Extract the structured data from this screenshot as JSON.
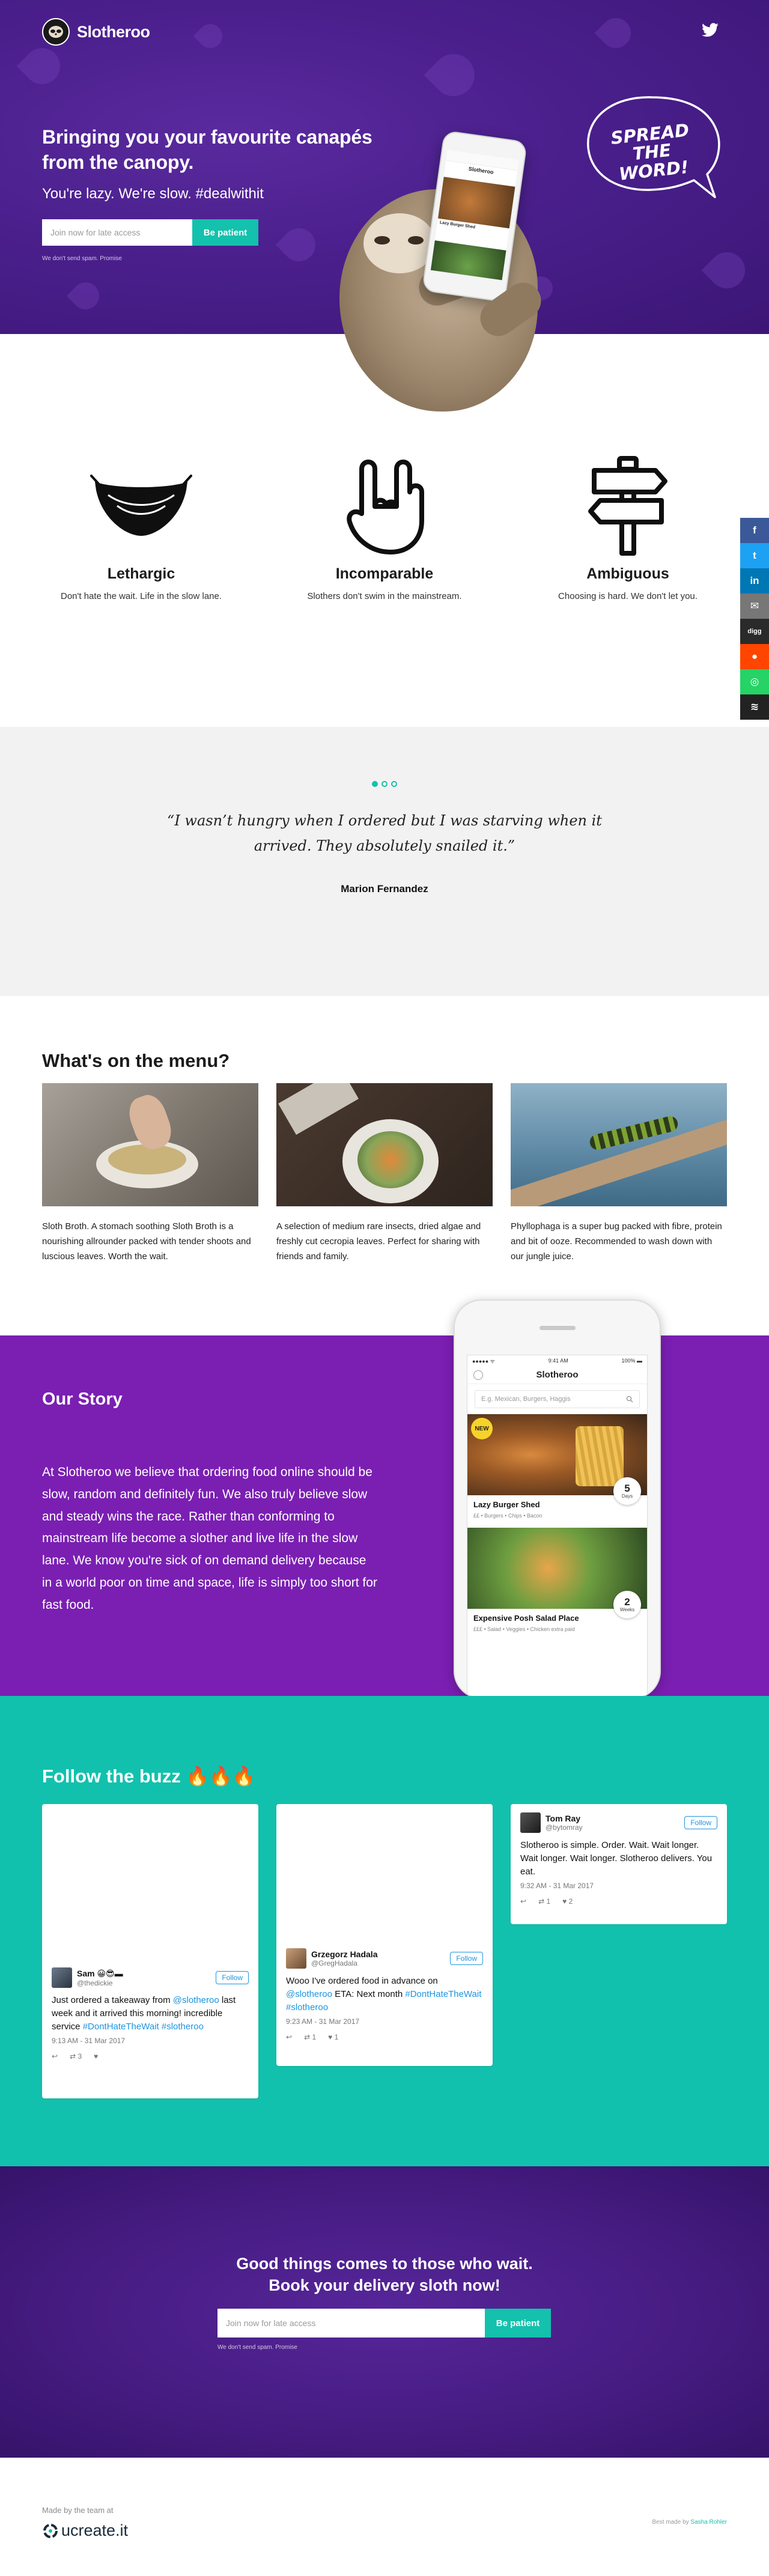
{
  "brand": {
    "name": "Slotheroo"
  },
  "header": {
    "twitter_icon": "twitter-icon"
  },
  "hero": {
    "title": "Bringing you your favourite canapés from the canopy.",
    "subtitle": "You're lazy. We're slow. #dealwithit",
    "signup": {
      "placeholder": "Join now for late access",
      "button_label": "Be patient"
    },
    "no_spam": "We don't send spam. Promise",
    "badge_text": "SPREAD THE WORD!",
    "phone_app_title": "Slotheroo",
    "phone_card_label": "Lazy Burger Shed"
  },
  "share": [
    {
      "name": "facebook",
      "glyph": "f",
      "color": "#3b5998"
    },
    {
      "name": "twitter",
      "glyph": "t",
      "color": "#1da1f2"
    },
    {
      "name": "linkedin",
      "glyph": "in",
      "color": "#0077b5"
    },
    {
      "name": "email",
      "glyph": "✉",
      "color": "#777777"
    },
    {
      "name": "digg",
      "glyph": "digg",
      "color": "#2a2a2a"
    },
    {
      "name": "reddit",
      "glyph": "●",
      "color": "#ff4500"
    },
    {
      "name": "whatsapp",
      "glyph": "◎",
      "color": "#25d366"
    },
    {
      "name": "buffer",
      "glyph": "≋",
      "color": "#222222"
    }
  ],
  "features": [
    {
      "icon": "hammock-icon",
      "title": "Lethargic",
      "desc": "Don't hate the wait. Life in the slow lane."
    },
    {
      "icon": "rock-hand-icon",
      "title": "Incomparable",
      "desc": "Slothers don't swim in the mainstream."
    },
    {
      "icon": "signpost-icon",
      "title": "Ambiguous",
      "desc": "Choosing is hard. We don't let you."
    }
  ],
  "testimonial": {
    "quote": "“I wasn’t hungry when I ordered but I was starving when it arrived. They absolutely snailed it.”",
    "author": "Marion Fernandez",
    "active_index": 0,
    "count": 3
  },
  "menu": {
    "title": "What's on the menu?",
    "items": [
      {
        "image": "sloth-broth-photo",
        "desc": "Sloth Broth. A stomach soothing Sloth Broth is a nourishing allrounder packed with tender shoots and luscious leaves. Worth the wait."
      },
      {
        "image": "insect-salad-photo",
        "desc": "A selection of medium rare insects, dried algae and freshly cut cecropia leaves. Perfect for sharing with friends and family."
      },
      {
        "image": "caterpillar-photo",
        "desc": "Phyllophaga is a super bug packed with fibre, protein and bit of ooze. Recommended to wash down with our jungle juice."
      }
    ]
  },
  "story": {
    "title": "Our Story",
    "text": "At Slotheroo we believe that ordering food online should be slow, random and definitely fun. We also truly believe slow and steady wins the race. Rather than conforming to mainstream life become a slother and live life in the slow lane. We know you're sick of on demand delivery because in a world poor on time and space, life is simply too short for fast food.",
    "phone": {
      "status_left": "●●●●● ᯤ",
      "status_time": "9:41 AM",
      "status_right": "100% ▬",
      "app_title": "Slotheroo",
      "search_placeholder": "E.g. Mexican, Burgers, Haggis",
      "cards": [
        {
          "name": "Lazy Burger Shed",
          "tags": "££ • Burgers • Chips • Bacon",
          "badge_num": "5",
          "badge_unit": "Days",
          "new_label": "NEW"
        },
        {
          "name": "Expensive Posh Salad Place",
          "tags": "£££ • Salad • Veggies • Chicken extra paid",
          "badge_num": "2",
          "badge_unit": "Weeks"
        }
      ]
    }
  },
  "buzz": {
    "title": "Follow the buzz 🔥🔥🔥",
    "follow_label": "Follow",
    "tweets": [
      {
        "name": "Sam 😀😎▬",
        "handle": "@thedickie",
        "text_parts": [
          "Just ordered a takeaway from ",
          "@slotheroo",
          " last week and it arrived this morning! incredible service       ",
          "#DontHateTheWait",
          " ",
          "#slotheroo"
        ],
        "time": "9:13 AM - 31 Mar 2017",
        "retweets": "3",
        "likes": ""
      },
      {
        "name": "Grzegorz Hadala",
        "handle": "@GregHadala",
        "text_parts": [
          "Wooo I've ordered food in advance on ",
          "@slotheroo",
          "                ETA: Next month ",
          "#DontHateTheWait",
          " ",
          "#slotheroo"
        ],
        "time": "9:23 AM - 31 Mar 2017",
        "retweets": "1",
        "likes": "1"
      },
      {
        "name": "Tom Ray",
        "handle": "@bytomray",
        "text_parts": [
          "Slotheroo is simple. Order. Wait. Wait longer. Wait longer. Wait longer. Slotheroo delivers. You eat."
        ],
        "time": "9:32 AM - 31 Mar 2017",
        "retweets": "1",
        "likes": "2"
      }
    ]
  },
  "cta": {
    "title_line1": "Good things comes to those who wait.",
    "title_line2": "Book your delivery sloth now!",
    "signup": {
      "placeholder": "Join now for late access",
      "button_label": "Be patient"
    },
    "no_spam": "We don't send spam. Promise"
  },
  "footer": {
    "made_by": "Made by the team at",
    "company": "ucreate.it",
    "credit_prefix": "Best made by ",
    "credit_link": "Sasha Rohler"
  },
  "colors": {
    "purple": "#4d2190",
    "story_purple": "#7a1fb2",
    "teal": "#14c1ad",
    "buzz_teal": "#12c1ad"
  }
}
